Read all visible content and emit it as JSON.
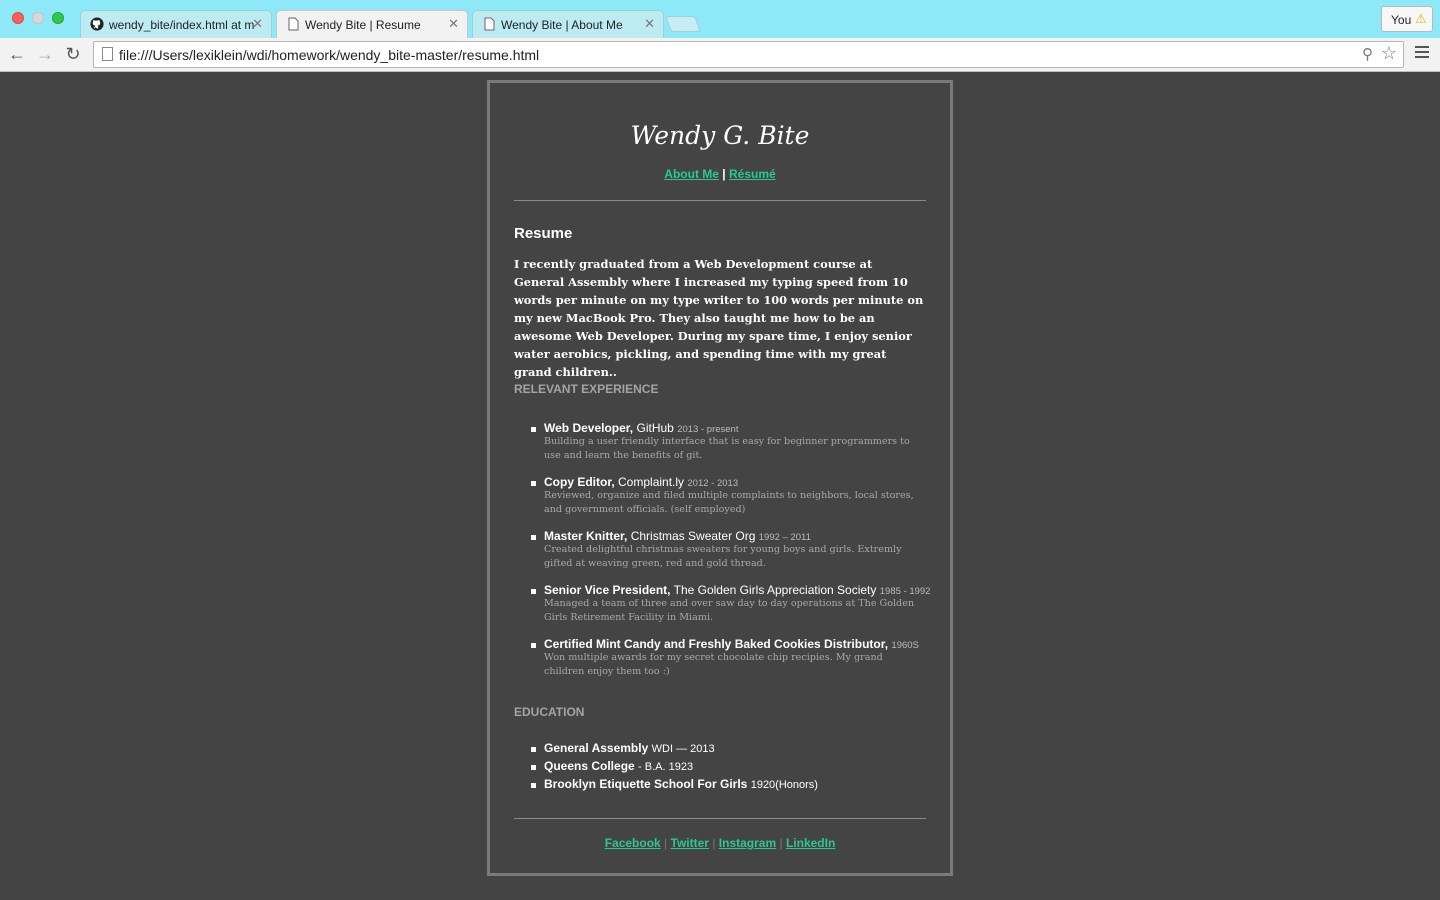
{
  "browser": {
    "tabs": [
      {
        "title": "wendy_bite/index.html at m",
        "icon": "github-icon"
      },
      {
        "title": "Wendy Bite | Resume",
        "icon": "page-icon"
      },
      {
        "title": "Wendy Bite | About Me",
        "icon": "page-icon"
      }
    ],
    "profile_label": "You",
    "url": "file:///Users/lexiklein/wdi/homework/wendy_bite-master/resume.html"
  },
  "page": {
    "name": "Wendy G. Bite",
    "nav": {
      "about": "About Me",
      "sep": "|",
      "resume": "Résumé"
    },
    "resume_heading": "Resume",
    "intro_before": "I recently graduated from a Web Development course at General Assembly where I increased my typing speed from 10 words per minute on my type writer to 100 words per minute on my new MacBook Pro. They also taught me how to be an ",
    "intro_strong": "awesome",
    "intro_after": " Web Developer. During my spare time, I enjoy senior water aerobics, pickling, and spending time with my great grand children..",
    "experience_heading": "RELEVANT EXPERIENCE",
    "jobs": [
      {
        "title": "Web Developer,",
        "org": "GitHub",
        "years": "2013 - present",
        "desc": "Building a user friendly interface that is easy for beginner programmers to use and learn the benefits of git."
      },
      {
        "title": "Copy Editor,",
        "org": "Complaint.ly",
        "years": "2012 - 2013",
        "desc": "Reviewed, organize and filed multiple complaints to neighbors, local stores, and government officials. (self employed)"
      },
      {
        "title": "Master Knitter,",
        "org": "Christmas Sweater Org",
        "years": "1992 – 2011",
        "desc": "Created delightful christmas sweaters for young boys and girls. Extremly gifted at weaving green, red and gold thread."
      },
      {
        "title": "Senior Vice President,",
        "org": "The Golden Girls Appreciation Society",
        "years": "1985 - 1992",
        "desc": "Managed a team of three and over saw day to day operations at The Golden Girls Retirement Facility in Miami."
      },
      {
        "title": "Certified Mint Candy and Freshly Baked Cookies Distributor,",
        "org": "",
        "years": "1960S",
        "desc": "Won multiple awards for my secret chocolate chip recipies. My grand children enjoy them too :)"
      }
    ],
    "education_heading": "EDUCATION",
    "education": [
      {
        "school": "General Assembly",
        "detail": "WDI — 2013"
      },
      {
        "school": "Queens College",
        "detail": "- B.A. 1923"
      },
      {
        "school": "Brooklyn Etiquette School For Girls",
        "detail": "1920(Honors)"
      }
    ],
    "footer_links": [
      "Facebook",
      "Twitter",
      "Instagram",
      "LinkedIn"
    ],
    "footer_sep": "|"
  },
  "colors": {
    "background": "#444444",
    "link": "#29c98f",
    "titlebar": "#8de9f7"
  }
}
